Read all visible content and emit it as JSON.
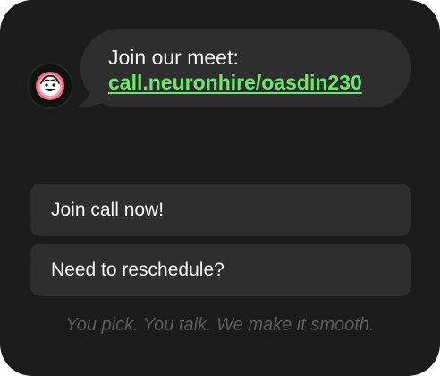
{
  "chat": {
    "message_title": "Join our meet:",
    "message_link": "call.neuronhire/oasdin230"
  },
  "options": [
    {
      "label": "Join call now!"
    },
    {
      "label": "Need to reschedule?"
    }
  ],
  "footer": {
    "tagline": "You pick. You talk. We make it smooth."
  },
  "colors": {
    "card_background": "#1b1b1b",
    "bubble_background": "#2e2e2e",
    "link_accent": "#6ee86e",
    "tagline_text": "#5c5c5c"
  },
  "icons": {
    "avatar": "smiling-brain-face-icon"
  }
}
